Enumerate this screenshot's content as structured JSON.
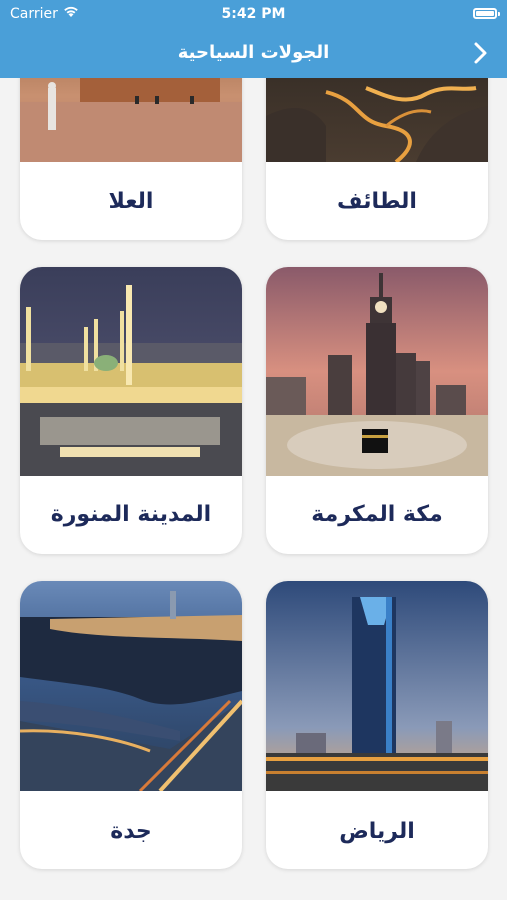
{
  "status_bar": {
    "carrier": "Carrier",
    "time": "5:42 PM"
  },
  "nav": {
    "title": "الجولات السياحية",
    "back_icon": "chevron-right-icon"
  },
  "cities": [
    {
      "name": "الطائف",
      "image": "winding-mountain-road-photo"
    },
    {
      "name": "العلا",
      "image": "desert-rocks-photo"
    },
    {
      "name": "مكة المكرمة",
      "image": "makkah-clock-tower-photo"
    },
    {
      "name": "المدينة المنورة",
      "image": "madinah-mosque-photo"
    },
    {
      "name": "الرياض",
      "image": "riyadh-kingdom-tower-photo"
    },
    {
      "name": "جدة",
      "image": "jeddah-coast-photo"
    }
  ],
  "colors": {
    "bar": "#4a9fd8",
    "label": "#1d2a5a",
    "background": "#f3f3f3"
  }
}
